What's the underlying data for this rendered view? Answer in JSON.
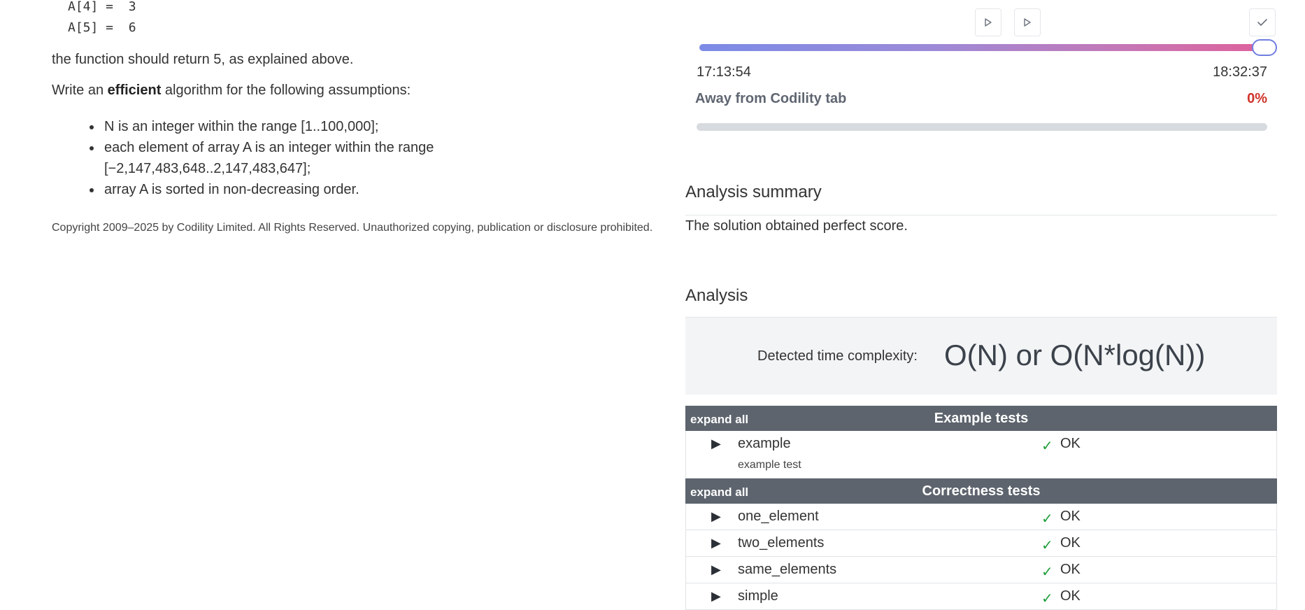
{
  "problem": {
    "code_lines": [
      "A[4] =  3",
      "A[5] =  6"
    ],
    "return_text": "the function should return 5, as explained above.",
    "assumptions_intro_pre": "Write an ",
    "assumptions_intro_bold": "efficient",
    "assumptions_intro_post": " algorithm for the following assumptions:",
    "assumptions": [
      "N is an integer within the range [1..100,000];",
      "each element of array A is an integer within the range [−2,147,483,648..2,147,483,647];",
      "array A is sorted in non-decreasing order."
    ],
    "copyright": "Copyright 2009–2025 by Codility Limited. All Rights Reserved. Unauthorized copying, publication or disclosure prohibited."
  },
  "playback": {
    "play_icon": "play-icon",
    "step_icon": "play-icon",
    "check_icon": "check-icon",
    "progress_fraction": 1.0,
    "start_time": "17:13:54",
    "end_time": "18:32:37",
    "away_label": "Away from Codility tab",
    "away_percent": "0%",
    "away_fraction": 0
  },
  "analysis_summary": {
    "title": "Analysis summary",
    "text": "The solution obtained perfect score."
  },
  "analysis": {
    "title": "Analysis",
    "complexity_label": "Detected time complexity:",
    "complexity_value": "O(N) or O(N*log(N))"
  },
  "test_groups": [
    {
      "expand_label": "expand all",
      "title": "Example tests",
      "tests": [
        {
          "name": "example",
          "description": "example test",
          "status": "OK"
        }
      ]
    },
    {
      "expand_label": "expand all",
      "title": "Correctness tests",
      "tests": [
        {
          "name": "one_element",
          "status": "OK"
        },
        {
          "name": "two_elements",
          "status": "OK"
        },
        {
          "name": "same_elements",
          "status": "OK"
        },
        {
          "name": "simple",
          "status": "OK"
        }
      ]
    }
  ],
  "colors": {
    "ok_check": "#1e9e3a",
    "away_percent": "#d0342c",
    "group_header": "#5d646d"
  }
}
